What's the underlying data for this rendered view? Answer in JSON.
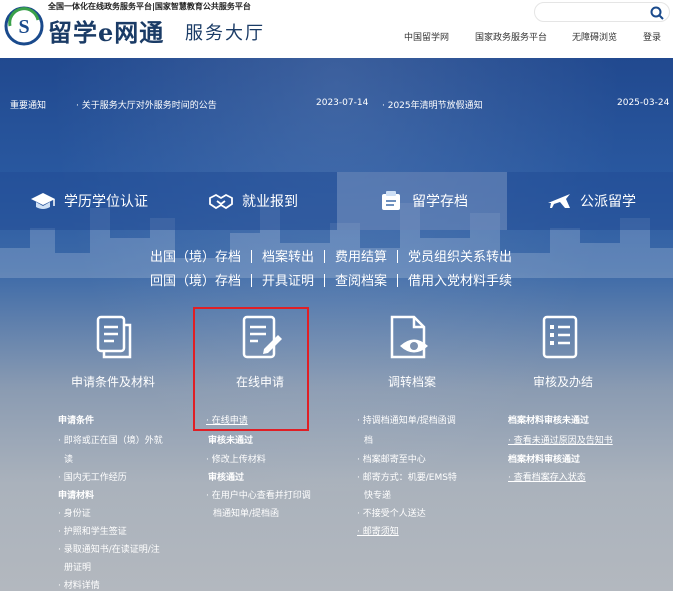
{
  "header": {
    "tagline": "全国一体化在线政务服务平台|国家智慧教育公共服务平台",
    "logo_title": "留学e网通",
    "logo_sub": "服务大厅",
    "nav": [
      "中国留学网",
      "国家政务服务平台",
      "无障碍浏览",
      "登录"
    ],
    "search_placeholder": ""
  },
  "notice": {
    "label": "重要通知",
    "items": [
      {
        "title": "· 关于服务大厅对外服务时间的公告",
        "date": "2023-07-14"
      },
      {
        "title": "· 2025年清明节放假通知",
        "date": "2025-03-24"
      }
    ]
  },
  "categories": [
    {
      "label": "学历学位认证",
      "icon": "graduation-cap-icon",
      "active": false
    },
    {
      "label": "就业报到",
      "icon": "handshake-icon",
      "active": false
    },
    {
      "label": "留学存档",
      "icon": "archive-folder-icon",
      "active": true
    },
    {
      "label": "公派留学",
      "icon": "airplane-icon",
      "active": false
    }
  ],
  "submenu": {
    "row1": [
      "出国（境）存档",
      "档案转出",
      "费用结算",
      "党员组织关系转出"
    ],
    "row2": [
      "回国（境）存档",
      "开具证明",
      "查阅档案",
      "借用入党材料手续"
    ]
  },
  "features": [
    {
      "label": "申请条件及材料",
      "icon": "documents-icon"
    },
    {
      "label": "在线申请",
      "icon": "edit-document-icon"
    },
    {
      "label": "调转档案",
      "icon": "document-eye-icon"
    },
    {
      "label": "审核及办结",
      "icon": "checklist-icon"
    }
  ],
  "lists": {
    "col1": [
      {
        "text": "申请条件",
        "type": "head"
      },
      {
        "text": "· 即将或正在国（境）外就",
        "type": "item"
      },
      {
        "text": "读",
        "type": "cont"
      },
      {
        "text": "· 国内无工作经历",
        "type": "item"
      },
      {
        "text": "申请材料",
        "type": "head"
      },
      {
        "text": "· 身份证",
        "type": "item"
      },
      {
        "text": "· 护照和学生签证",
        "type": "item"
      },
      {
        "text": "· 录取通知书/在读证明/注",
        "type": "item"
      },
      {
        "text": "册证明",
        "type": "cont"
      },
      {
        "text": "· 材料详情",
        "type": "item"
      }
    ],
    "col2": [
      {
        "text": "· 在线申请",
        "type": "link"
      },
      {
        "text": "审核未通过",
        "type": "head"
      },
      {
        "text": "· 修改上传材料",
        "type": "item"
      },
      {
        "text": "审核通过",
        "type": "head"
      },
      {
        "text": "· 在用户中心查看并打印调",
        "type": "item"
      },
      {
        "text": "档通知单/提档函",
        "type": "cont"
      }
    ],
    "col3": [
      {
        "text": "· 持调档通知单/提档函调",
        "type": "item"
      },
      {
        "text": "档",
        "type": "cont"
      },
      {
        "text": "· 档案邮寄至中心",
        "type": "item"
      },
      {
        "text": "· 邮寄方式：机要/EMS特",
        "type": "item"
      },
      {
        "text": "快专递",
        "type": "cont"
      },
      {
        "text": "· 不接受个人送达",
        "type": "item"
      },
      {
        "text": "· 邮寄须知",
        "type": "link"
      }
    ],
    "col4": [
      {
        "text": "档案材料审核未通过",
        "type": "head"
      },
      {
        "text": "· 查看未通过原因及告知书",
        "type": "link"
      },
      {
        "text": "档案材料审核通过",
        "type": "head"
      },
      {
        "text": "· 查看档案存入状态",
        "type": "link"
      }
    ]
  }
}
